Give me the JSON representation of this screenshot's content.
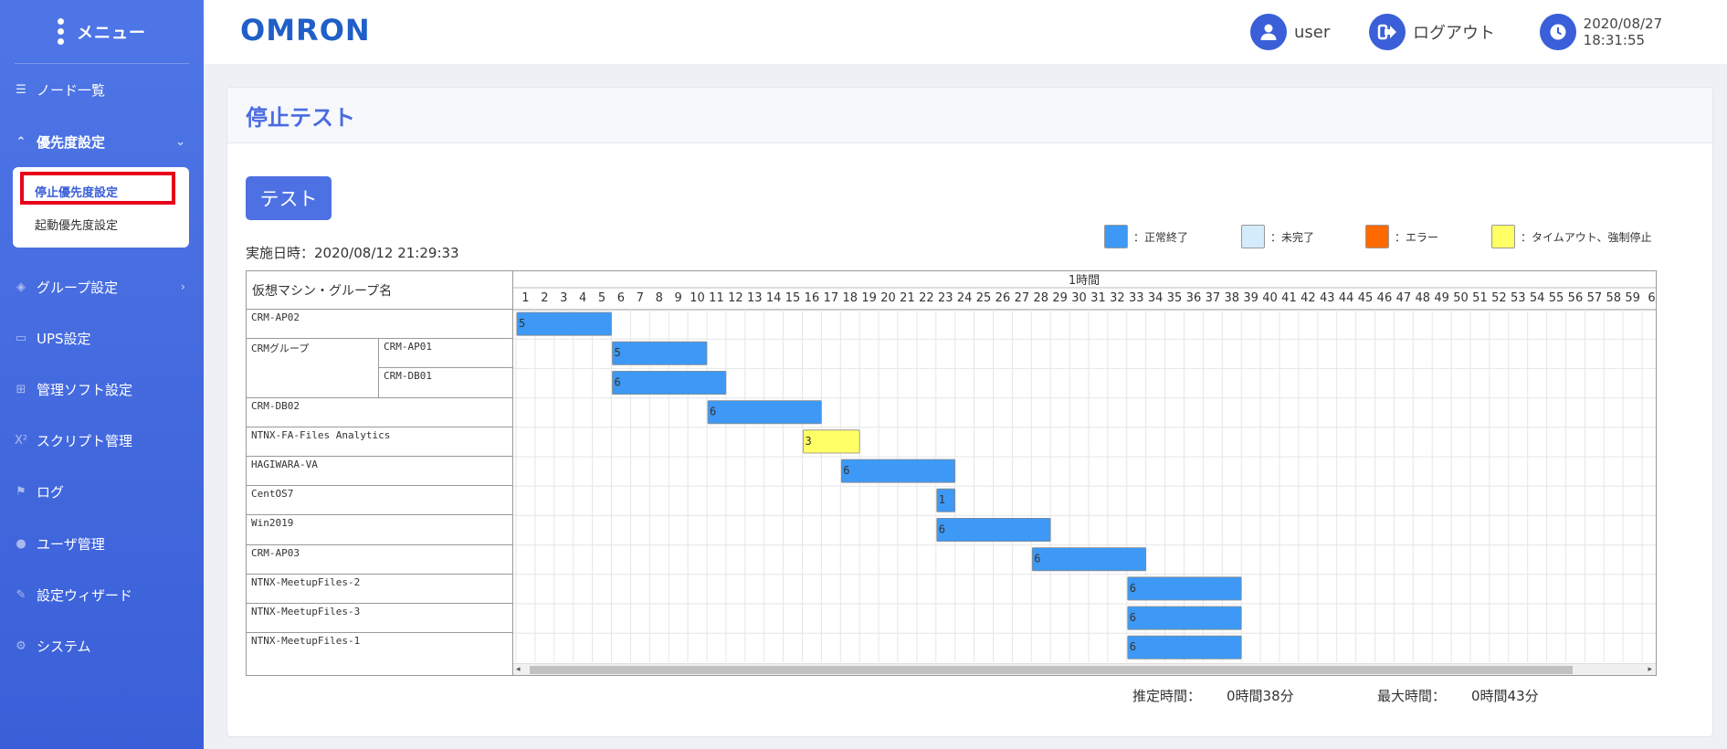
{
  "sidebar": {
    "title": "メニュー",
    "items": [
      {
        "label": "ノード一覧",
        "icon": "list-icon",
        "glyph": "☰"
      },
      {
        "label": "優先度設定",
        "icon": "double-chevron-up-icon",
        "glyph": "⌃"
      },
      {
        "label": "グループ設定",
        "icon": "layers-icon",
        "glyph": "◈"
      },
      {
        "label": "UPS設定",
        "icon": "battery-icon",
        "glyph": "▭"
      },
      {
        "label": "管理ソフト設定",
        "icon": "sitemap-icon",
        "glyph": "⊞"
      },
      {
        "label": "スクリプト管理",
        "icon": "superscript-icon",
        "glyph": "X²"
      },
      {
        "label": "ログ",
        "icon": "flag-icon",
        "glyph": "⚑"
      },
      {
        "label": "ユーザ管理",
        "icon": "user-icon",
        "glyph": "●"
      },
      {
        "label": "設定ウィザード",
        "icon": "edit-icon",
        "glyph": "✎"
      },
      {
        "label": "システム",
        "icon": "gear-icon",
        "glyph": "⚙"
      }
    ],
    "submenu": [
      "停止優先度設定",
      "起動優先度設定"
    ]
  },
  "header": {
    "logo": "OMRON",
    "user": "user",
    "logout": "ログアウト",
    "datetime": "2020/08/27 18:31:55"
  },
  "page": {
    "title": "停止テスト",
    "test_button": "テスト",
    "run_date": "実施日時：2020/08/12 21:29:33",
    "colors": {
      "normal": "#3d99f5",
      "incomplete": "#d4ebfb",
      "error": "#ff6a00",
      "timeout": "#ffff66"
    },
    "legend": [
      {
        "label": "：正常終了",
        "color": "#3d99f5"
      },
      {
        "label": "：未完了",
        "color": "#d4ebfb"
      },
      {
        "label": "：エラー",
        "color": "#ff6a00"
      },
      {
        "label": "：タイムアウト、強制停止",
        "color": "#ffff66"
      }
    ],
    "gantt": {
      "name_header": "仮想マシン・グループ名",
      "time_header": "1時間",
      "minutes": [
        "1",
        "2",
        "3",
        "4",
        "5",
        "6",
        "7",
        "8",
        "9",
        "10",
        "11",
        "12",
        "13",
        "14",
        "15",
        "16",
        "17",
        "18",
        "19",
        "20",
        "21",
        "22",
        "23",
        "24",
        "25",
        "26",
        "27",
        "28",
        "29",
        "30",
        "31",
        "32",
        "33",
        "34",
        "35",
        "36",
        "37",
        "38",
        "39",
        "40",
        "41",
        "42",
        "43",
        "44",
        "45",
        "46",
        "47",
        "48",
        "49",
        "50",
        "51",
        "52",
        "53",
        "54",
        "55",
        "56",
        "57",
        "58",
        "59",
        "6"
      ],
      "rows": [
        {
          "name": "CRM-AP02",
          "start": 0,
          "duration": 5,
          "status": "normal"
        },
        {
          "name": "CRMグループ",
          "sub": "CRM-AP01",
          "start": 5,
          "duration": 5,
          "status": "normal"
        },
        {
          "name": "",
          "sub": "CRM-DB01",
          "start": 5,
          "duration": 6,
          "status": "normal"
        },
        {
          "name": "CRM-DB02",
          "start": 10,
          "duration": 6,
          "status": "normal"
        },
        {
          "name": "NTNX-FA-Files Analytics",
          "start": 15,
          "duration": 3,
          "status": "timeout"
        },
        {
          "name": "HAGIWARA-VA",
          "start": 17,
          "duration": 6,
          "status": "normal"
        },
        {
          "name": "CentOS7",
          "start": 22,
          "duration": 1,
          "status": "normal"
        },
        {
          "name": "Win2019",
          "start": 22,
          "duration": 6,
          "status": "normal"
        },
        {
          "name": "CRM-AP03",
          "start": 27,
          "duration": 6,
          "status": "normal"
        },
        {
          "name": "NTNX-MeetupFiles-2",
          "start": 32,
          "duration": 6,
          "status": "normal"
        },
        {
          "name": "NTNX-MeetupFiles-3",
          "start": 32,
          "duration": 6,
          "status": "normal"
        },
        {
          "name": "NTNX-MeetupFiles-1",
          "start": 32,
          "duration": 6,
          "status": "normal"
        }
      ]
    },
    "estimated_label": "推定時間：",
    "estimated_value": "0時間38分",
    "max_label": "最大時間：",
    "max_value": "0時間43分"
  }
}
